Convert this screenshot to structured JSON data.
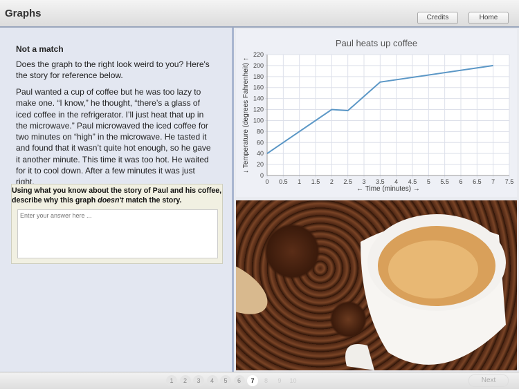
{
  "header": {
    "title": "Graphs",
    "credits_label": "Credits",
    "home_label": "Home"
  },
  "left": {
    "heading": "Not a match",
    "intro": "Does the graph to the right look weird to you? Here's the story for reference below.",
    "story": "Paul wanted a cup of coffee but he was too lazy to make one. “I know,” he thought, “there’s a glass of iced coffee in the refrigerator. I’ll just heat that up in the microwave.” Paul microwaved the iced coffee for two minutes on “high” in the microwave. He tasted it and found that it wasn’t quite hot enough, so he gave it another minute. This time it was too hot. He waited for it to cool down. After a few minutes it was just right.",
    "question_pre": "Using what you know about the story of Paul and his coffee, describe why this graph ",
    "question_em": "doesn't",
    "question_post": " match the story.",
    "answer_placeholder": "Enter your answer here ...",
    "answer_value": ""
  },
  "chart_data": {
    "type": "line",
    "title": "Paul heats up coffee",
    "xlabel": "← Time (minutes) →",
    "ylabel": "↓ Temperature (degrees Fahrenheit) ↑",
    "xlim": [
      0,
      7.5
    ],
    "ylim": [
      0,
      220
    ],
    "xticks": [
      "0",
      "0.5",
      "1",
      "1.5",
      "2",
      "2.5",
      "3",
      "3.5",
      "4",
      "4.5",
      "5",
      "5.5",
      "6",
      "6.5",
      "7",
      "7.5"
    ],
    "yticks": [
      "0",
      "20",
      "40",
      "60",
      "80",
      "100",
      "120",
      "140",
      "160",
      "180",
      "200",
      "220"
    ],
    "grid": true,
    "series": [
      {
        "name": "Temperature",
        "color": "#5b97c6",
        "x": [
          0,
          2,
          2.5,
          3.5,
          7
        ],
        "y": [
          40,
          120,
          118,
          170,
          200
        ]
      }
    ]
  },
  "footer": {
    "pages": [
      "1",
      "2",
      "3",
      "4",
      "5",
      "6",
      "7",
      "8",
      "9",
      "10"
    ],
    "current": 7,
    "next_label": "Next"
  }
}
